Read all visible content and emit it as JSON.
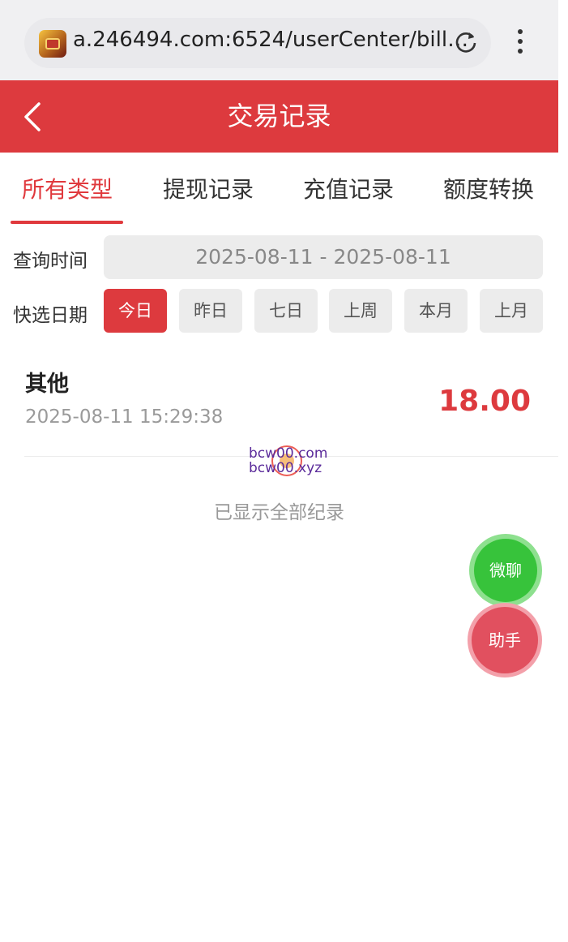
{
  "browser": {
    "url": "a.246494.com:6524/userCenter/bill…"
  },
  "header": {
    "title": "交易记录"
  },
  "tabs": [
    {
      "label": "所有类型",
      "active": true
    },
    {
      "label": "提现记录",
      "active": false
    },
    {
      "label": "充值记录",
      "active": false
    },
    {
      "label": "额度转换",
      "active": false
    }
  ],
  "filters": {
    "query_time_label": "查询时间",
    "date_range": "2025-08-11 - 2025-08-11",
    "quick_select_label": "快选日期",
    "quick_options": [
      "今日",
      "昨日",
      "七日",
      "上周",
      "本月",
      "上月"
    ],
    "selected": "今日"
  },
  "records": [
    {
      "type": "其他",
      "time": "2025-08-11 15:29:38",
      "amount": "18.00"
    }
  ],
  "watermark": {
    "line1": "bcw00.com",
    "line2": "bcw00.xyz"
  },
  "footer_text": "已显示全部纪录",
  "floating_buttons": {
    "chat": "微聊",
    "assistant": "助手"
  },
  "colors": {
    "accent": "#dd3a3e",
    "chat_green": "#37c33b",
    "helper_pink": "#e1505f"
  }
}
